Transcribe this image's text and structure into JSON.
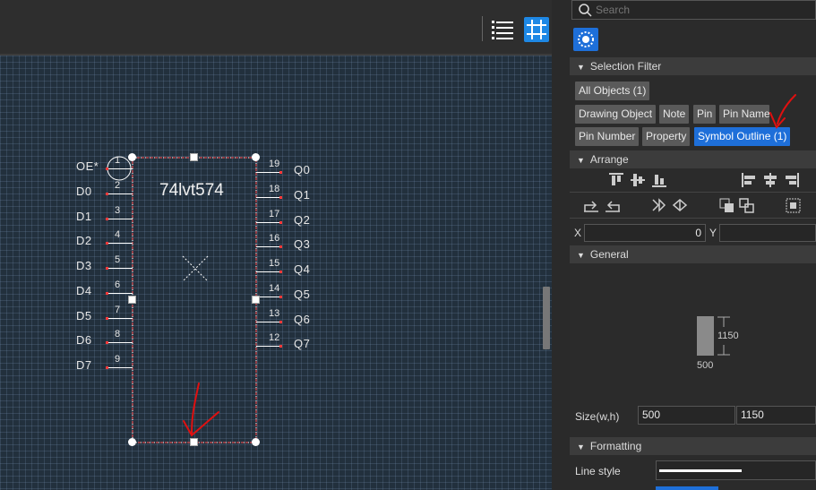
{
  "toolbar": {
    "list_icon": "list-icon",
    "grid_icon": "grid-icon"
  },
  "schematic": {
    "part_name": "74lvt574",
    "left_pins": [
      {
        "name": "OE*",
        "number": "1"
      },
      {
        "name": "D0",
        "number": "2"
      },
      {
        "name": "D1",
        "number": "3"
      },
      {
        "name": "D2",
        "number": "4"
      },
      {
        "name": "D3",
        "number": "5"
      },
      {
        "name": "D4",
        "number": "6"
      },
      {
        "name": "D5",
        "number": "7"
      },
      {
        "name": "D6",
        "number": "8"
      },
      {
        "name": "D7",
        "number": "9"
      }
    ],
    "right_pins": [
      {
        "name": "Q0",
        "number": "19"
      },
      {
        "name": "Q1",
        "number": "18"
      },
      {
        "name": "Q2",
        "number": "17"
      },
      {
        "name": "Q3",
        "number": "16"
      },
      {
        "name": "Q4",
        "number": "15"
      },
      {
        "name": "Q5",
        "number": "14"
      },
      {
        "name": "Q6",
        "number": "13"
      },
      {
        "name": "Q7",
        "number": "12"
      }
    ]
  },
  "panel": {
    "search_placeholder": "Search",
    "selection_filter": {
      "title": "Selection Filter",
      "chips": [
        {
          "label": "All Objects (1)",
          "active": false
        },
        {
          "label": "Drawing Object",
          "active": false
        },
        {
          "label": "Note",
          "active": false
        },
        {
          "label": "Pin",
          "active": false
        },
        {
          "label": "Pin Name",
          "active": false
        },
        {
          "label": "Pin Number",
          "active": false
        },
        {
          "label": "Property",
          "active": false
        },
        {
          "label": "Symbol Outline (1)",
          "active": true
        }
      ]
    },
    "arrange": {
      "title": "Arrange",
      "x_label": "X",
      "x_value": "0",
      "y_label": "Y",
      "y_value": ""
    },
    "general": {
      "title": "General",
      "preview_height": "1150",
      "preview_width": "500",
      "size_label": "Size(w,h)",
      "width_value": "500",
      "height_value": "1150"
    },
    "formatting": {
      "title": "Formatting",
      "line_style_label": "Line style"
    }
  },
  "colors": {
    "accent": "#1e6fd9",
    "pin_dot": "#ff3a3a",
    "canvas_bg": "#22303d",
    "annotation": "#e01010"
  }
}
